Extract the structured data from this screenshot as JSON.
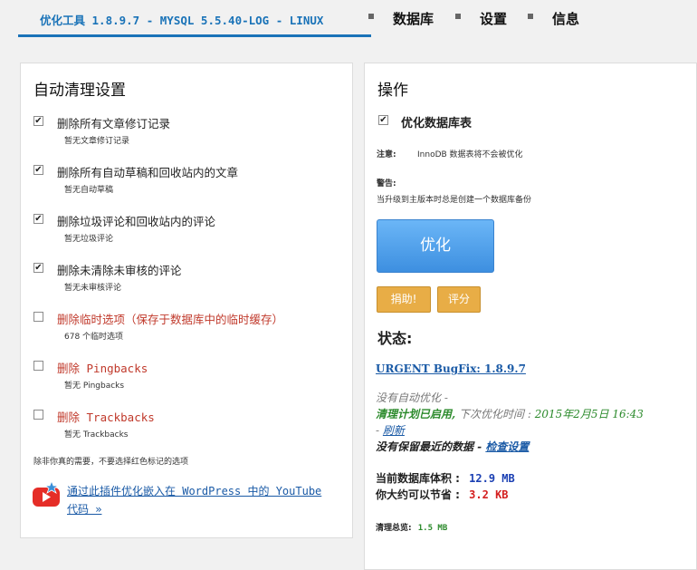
{
  "nav": {
    "active_tab": "优化工具 1.8.9.7 - MYSQL 5.5.40-LOG - LINUX",
    "tabs": [
      "数据库",
      "设置",
      "信息"
    ]
  },
  "left": {
    "title": "自动清理设置",
    "options": [
      {
        "label": "删除所有文章修订记录",
        "sub": "暂无文章修订记录",
        "checked": "✔",
        "red": false
      },
      {
        "label": "删除所有自动草稿和回收站内的文章",
        "sub": "暂无自动草稿",
        "checked": "✔",
        "red": false
      },
      {
        "label": "删除垃圾评论和回收站内的评论",
        "sub": "暂无垃圾评论",
        "checked": "✔",
        "red": false
      },
      {
        "label": "删除未清除未审核的评论",
        "sub": "暂无未审核评论",
        "checked": "✔",
        "red": false
      },
      {
        "label": "删除临时选项（保存于数据库中的临时缓存）",
        "sub": "678 个临时选项",
        "checked": "",
        "red": true
      },
      {
        "label": "删除 Pingbacks",
        "sub": "暂无 Pingbacks",
        "checked": "",
        "red": true
      },
      {
        "label": "删除 Trackbacks",
        "sub": "暂无 Trackbacks",
        "checked": "",
        "red": true
      }
    ],
    "note": "除非你真的需要，不要选择红色标记的选项",
    "youtube_link": "通过此插件优化嵌入在 WordPress 中的 YouTube 代码 »"
  },
  "right": {
    "title": "操作",
    "optimize_tables": {
      "label": "优化数据库表",
      "checked": "✔"
    },
    "note_label": "注意:",
    "note_text": "InnoDB 数据表将不会被优化",
    "warning_label": "警告:",
    "warning_text": "当升级到主版本时总是创建一个数据库备份",
    "optimize_button": "优化",
    "donate_button": "捐助!",
    "rate_button": "评分",
    "status_title": "状态:",
    "urgent_link": "URGENT BugFix: 1.8.9.7",
    "no_auto": "没有自动优化 -",
    "schedule_on": "清理计划已启用,",
    "next_label": "下次优化时间 :",
    "next_time": "2015年2月5日 16:43",
    "refresh_prefix": "-",
    "refresh_link": "刷新",
    "no_keep": "没有保留最近的数据 -",
    "check_settings": "检查设置",
    "db_size_label": "当前数据库体积 :",
    "db_size_value": "12.9 MB",
    "save_label": "你大约可以节省 :",
    "save_value": "3.2 KB",
    "total_label": "清理总览:",
    "total_value": "1.5 MB"
  },
  "colors": {
    "accent": "#1a73b8",
    "red": "#c0392b",
    "green": "#2b8a2b",
    "gold": "#e8ad46"
  }
}
